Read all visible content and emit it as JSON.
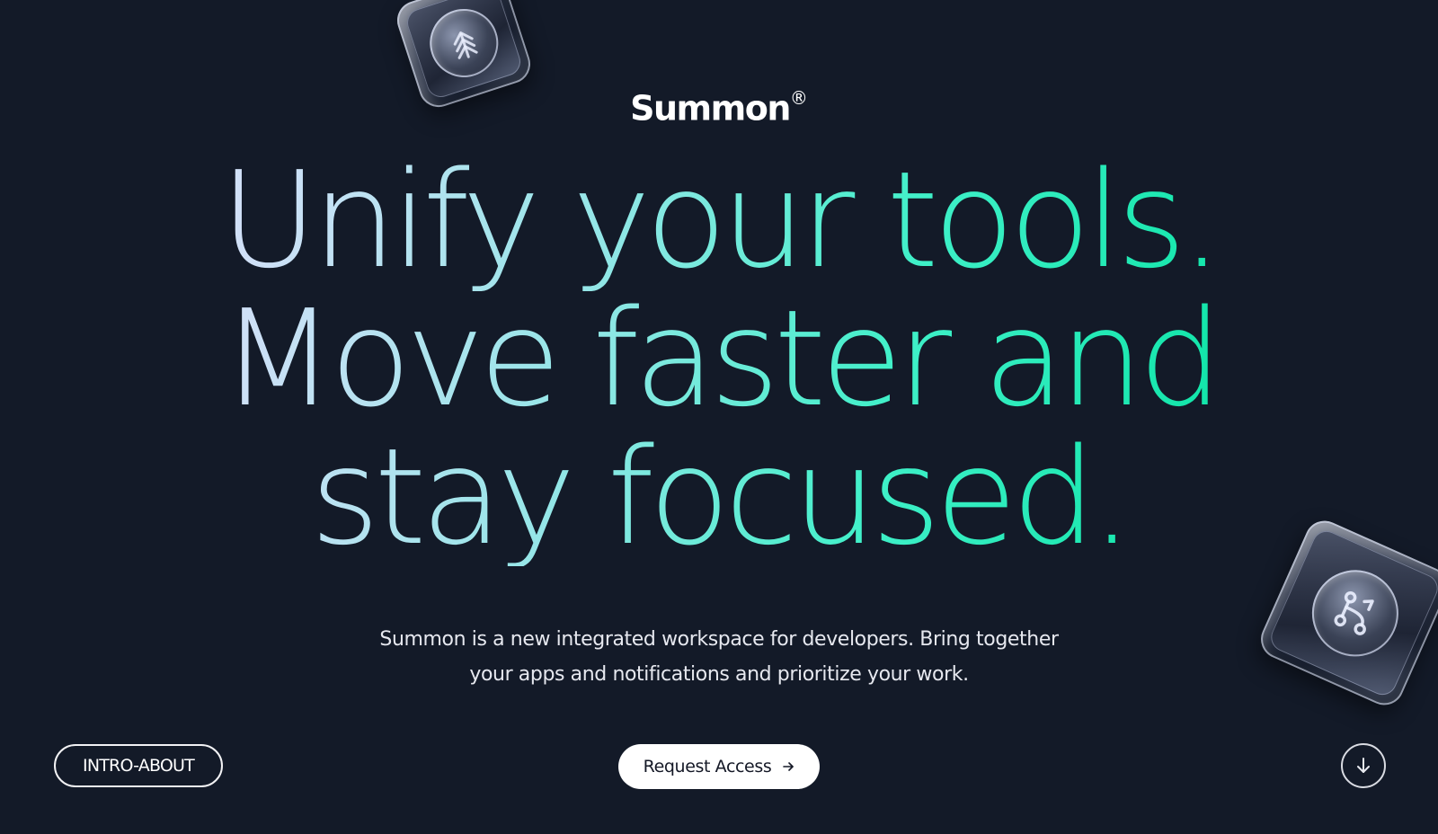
{
  "brand": {
    "name": "Summon",
    "registered_mark": "®"
  },
  "hero": {
    "headline_lines": [
      "Unify your tools.",
      "Move faster and",
      "stay focused."
    ],
    "description_lines": [
      "Summon is a new integrated workspace for developers. Bring together",
      "your apps and notifications and prioritize your work."
    ]
  },
  "footer": {
    "section_label": "INTRO-ABOUT",
    "cta_label": "Request Access",
    "cta_icon": "arrow-right-icon",
    "scroll_icon": "arrow-down-icon"
  },
  "decorations": {
    "top_keycap_icon": "stacked-arrows-icon",
    "right_keycap_icon": "merge-branch-icon"
  },
  "colors": {
    "background": "#131a28",
    "headline_gradient_start": "#e3e6fb",
    "headline_gradient_end": "#0ee0a4",
    "cta_background": "#ffffff"
  }
}
